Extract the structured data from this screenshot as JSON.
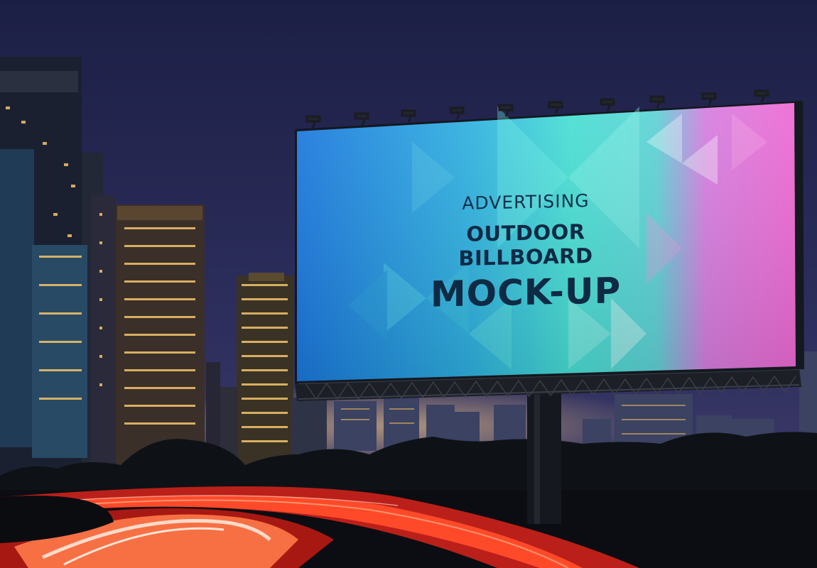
{
  "billboard": {
    "line1": "ADVERTISING",
    "line2": "OUTDOOR BILLBOARD",
    "line3": "MOCK-UP"
  },
  "colors": {
    "sky_top": "#1d2148",
    "sky_bottom": "#3a3f6e",
    "board_blue": "#1a7fe0",
    "board_cyan": "#41d9d3",
    "board_pink": "#e66bd8",
    "text_dark": "#0e2a45",
    "light_trail_red": "#ff3b2a",
    "light_trail_white": "#ffe6d8"
  }
}
